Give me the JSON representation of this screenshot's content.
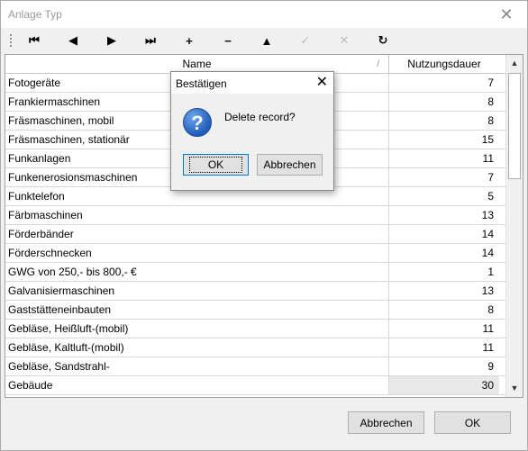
{
  "window": {
    "title": "Anlage Typ",
    "close_glyph": "✕"
  },
  "toolbar": {
    "buttons": [
      {
        "name": "first-record",
        "icon": "first-icon",
        "glyph": "⏮",
        "enabled": true
      },
      {
        "name": "prior-record",
        "icon": "prior-icon",
        "glyph": "◀",
        "enabled": true
      },
      {
        "name": "next-record",
        "icon": "next-icon",
        "glyph": "▶",
        "enabled": true
      },
      {
        "name": "last-record",
        "icon": "last-icon",
        "glyph": "⏭",
        "enabled": true
      },
      {
        "name": "insert-record",
        "icon": "plus-icon",
        "glyph": "+",
        "enabled": true
      },
      {
        "name": "delete-record",
        "icon": "minus-icon",
        "glyph": "−",
        "enabled": true
      },
      {
        "name": "edit-record",
        "icon": "triangle-up-icon",
        "glyph": "▲",
        "enabled": true
      },
      {
        "name": "post-edit",
        "icon": "check-icon",
        "glyph": "✓",
        "enabled": false
      },
      {
        "name": "cancel-edit",
        "icon": "cancel-icon",
        "glyph": "✕",
        "enabled": false
      },
      {
        "name": "refresh-data",
        "icon": "refresh-icon",
        "glyph": "↻",
        "enabled": true
      }
    ]
  },
  "grid": {
    "columns": [
      "Name",
      "Nutzungsdauer"
    ],
    "sort_mark": "/",
    "rows": [
      {
        "name": "Fotogeräte",
        "dauer": "7"
      },
      {
        "name": "Frankiermaschinen",
        "dauer": "8"
      },
      {
        "name": "Fräsmaschinen, mobil",
        "dauer": "8"
      },
      {
        "name": "Fräsmaschinen, stationär",
        "dauer": "15"
      },
      {
        "name": "Funkanlagen",
        "dauer": "11"
      },
      {
        "name": "Funkenerosionsmaschinen",
        "dauer": "7"
      },
      {
        "name": "Funktelefon",
        "dauer": "5"
      },
      {
        "name": "Färbmaschinen",
        "dauer": "13"
      },
      {
        "name": "Förderbänder",
        "dauer": "14"
      },
      {
        "name": "Förderschnecken",
        "dauer": "14"
      },
      {
        "name": "GWG von 250,- bis  800,- €",
        "dauer": "1"
      },
      {
        "name": "Galvanisiermaschinen",
        "dauer": "13"
      },
      {
        "name": "Gaststätteneinbauten",
        "dauer": "8"
      },
      {
        "name": "Gebläse, Heißluft-(mobil)",
        "dauer": "11"
      },
      {
        "name": "Gebläse, Kaltluft-(mobil)",
        "dauer": "11"
      },
      {
        "name": "Gebläse, Sandstrahl-",
        "dauer": "9"
      },
      {
        "name": "Gebäude",
        "dauer": "30"
      }
    ]
  },
  "footer": {
    "cancel_label": "Abbrechen",
    "ok_label": "OK"
  },
  "dialog": {
    "title": "Bestätigen",
    "close_glyph": "✕",
    "icon_glyph": "?",
    "message": "Delete record?",
    "ok_label": "OK",
    "cancel_label": "Abbrechen"
  }
}
